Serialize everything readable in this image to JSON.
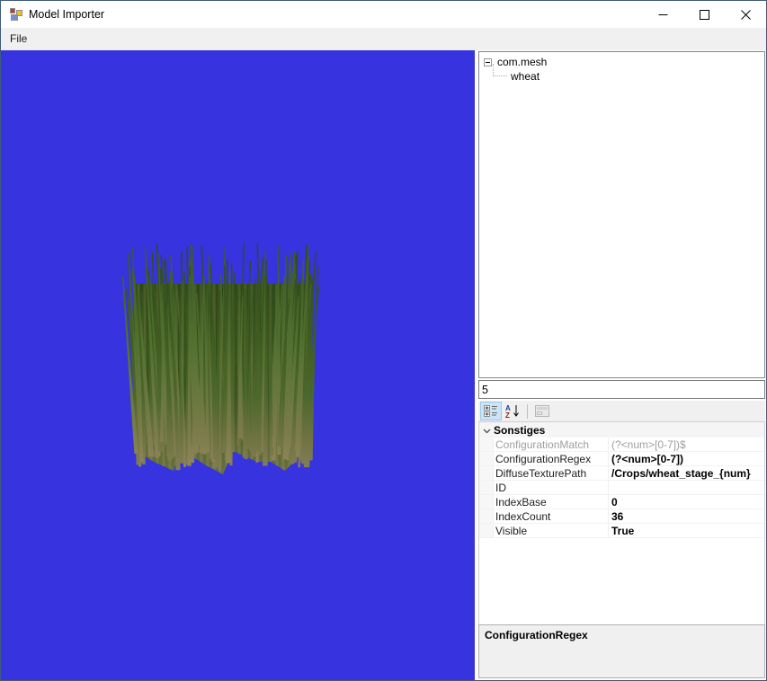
{
  "window": {
    "title": "Model Importer"
  },
  "menu": {
    "items": [
      {
        "label": "File"
      }
    ]
  },
  "viewport": {
    "background_color": "#3633DF",
    "model_name": "wheat"
  },
  "tree": {
    "root": {
      "label": "com.mesh",
      "expanded": true
    },
    "child": {
      "label": "wheat"
    }
  },
  "index_input": {
    "value": "5"
  },
  "property_grid": {
    "toolbar": {
      "az_icon": {
        "top": "A",
        "bottom": "Z"
      }
    },
    "category": {
      "label": "Sonstiges"
    },
    "rows": [
      {
        "name": "ConfigurationMatch",
        "value": "(?<num>[0-7])$",
        "disabled": true,
        "bold": false
      },
      {
        "name": "ConfigurationRegex",
        "value": "(?<num>[0-7])",
        "disabled": false,
        "bold": true
      },
      {
        "name": "DiffuseTexturePath",
        "value": "/Crops/wheat_stage_{num}",
        "disabled": false,
        "bold": true
      },
      {
        "name": "ID",
        "value": "",
        "disabled": false,
        "bold": false
      },
      {
        "name": "IndexBase",
        "value": "0",
        "disabled": false,
        "bold": true
      },
      {
        "name": "IndexCount",
        "value": "36",
        "disabled": false,
        "bold": true
      },
      {
        "name": "Visible",
        "value": "True",
        "disabled": false,
        "bold": true
      }
    ],
    "help": {
      "title": "ConfigurationRegex"
    }
  },
  "colors": {
    "viewport_blue": "#3633DF",
    "toolbar_selection": "#CCE4F7",
    "window_frame": "#3D5C7A"
  }
}
